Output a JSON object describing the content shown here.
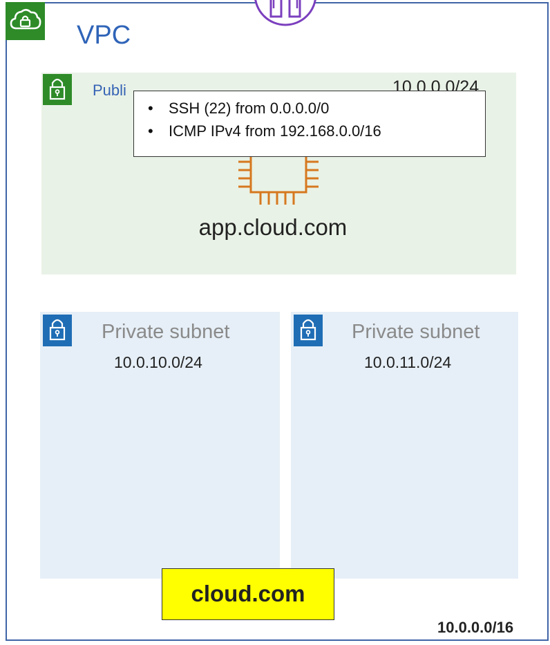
{
  "vpc": {
    "label": "VPC",
    "cidr": "10.0.0.0/16",
    "icon": "cloud-lock-icon",
    "color": "#2e8b28"
  },
  "internet_gateway": {
    "icon": "internet-gateway-icon",
    "color": "#7b3fbe"
  },
  "public_subnet": {
    "name": "Publi",
    "cidr": "10.0.0.0/24",
    "icon": "lock-icon",
    "background": "#e9f2e6"
  },
  "security_group": {
    "rules": [
      "SSH (22) from 0.0.0.0/0",
      "ICMP IPv4 from 192.168.0.0/16"
    ]
  },
  "instance": {
    "name": "app.cloud.com",
    "icon": "ec2-instance-icon",
    "color": "#d6781f"
  },
  "private_subnets": [
    {
      "name": "Private subnet",
      "cidr": "10.0.10.0/24",
      "icon": "lock-icon"
    },
    {
      "name": "Private subnet",
      "cidr": "10.0.11.0/24",
      "icon": "lock-icon"
    }
  ],
  "private_subnet_style": {
    "background": "#e6eff7",
    "icon_color": "#1f6db5"
  },
  "hosted_zone": {
    "label": "cloud.com",
    "color": "#ffff00"
  }
}
